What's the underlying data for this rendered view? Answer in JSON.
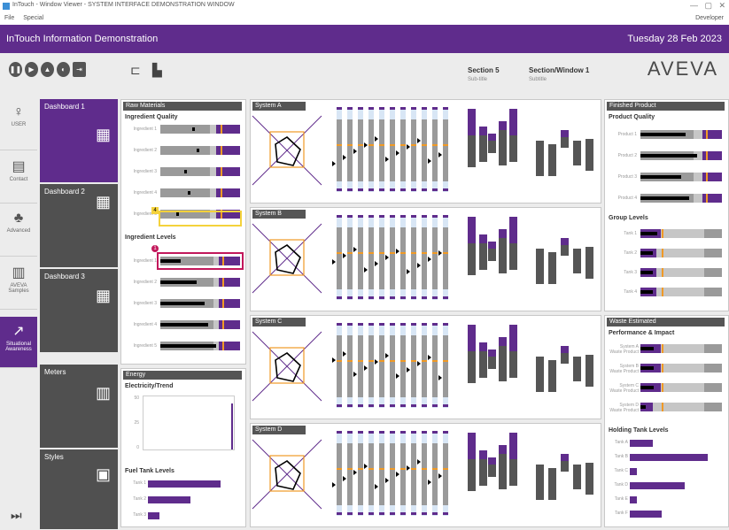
{
  "window": {
    "title": "InTouch - Window Viewer - SYSTEM INTERFACE DEMONSTRATION WINDOW",
    "menu": [
      "File",
      "Special"
    ],
    "menu_right": "Developer"
  },
  "header": {
    "title": "InTouch Information Demonstration",
    "date": "Tuesday 28 Feb 2023"
  },
  "toolbar": {
    "icons": [
      "pause-icon",
      "play-icon",
      "alarm-icon",
      "contrast-icon",
      "exit-icon"
    ],
    "section": {
      "label": "Section 5",
      "sub": "Sub-title"
    },
    "window": {
      "label": "Section/Window 1",
      "sub": "Subtitle"
    },
    "logo": "AVEVA"
  },
  "sidebar": {
    "items": [
      {
        "icon": "person-icon",
        "label": "USER"
      },
      {
        "icon": "contact-icon",
        "label": "Contact"
      },
      {
        "icon": "group-icon",
        "label": "Advanced"
      },
      {
        "icon": "samples-icon",
        "label": "AVEVA Samples"
      },
      {
        "icon": "graph-icon",
        "label": "Situational Awareness"
      }
    ],
    "bottom_icon": "skip-forward-icon"
  },
  "dashboards": [
    {
      "label": "Dashboard 1",
      "icon": "dashboard-icon",
      "active": true
    },
    {
      "label": "Dashboard 2",
      "icon": "dashboard-icon",
      "active": false
    },
    {
      "label": "Dashboard 3",
      "icon": "dashboard-icon",
      "active": false
    },
    {
      "label": "Meters",
      "icon": "meters-icon",
      "active": false
    },
    {
      "label": "Styles",
      "icon": "styles-icon",
      "active": false
    }
  ],
  "raw_materials": {
    "title": "Raw Materials",
    "quality_title": "Ingredient Quality",
    "quality_labels": [
      "Ingredient 1",
      "Ingredient 2",
      "Ingredient 3",
      "Ingredient 4",
      "Ingredient 5"
    ],
    "quality_levels": [
      0.4,
      0.45,
      0.3,
      0.35,
      0.2
    ],
    "level_title": "Ingredient Levels",
    "level_labels": [
      "Ingredient 1",
      "Ingredient 2",
      "Ingredient 3",
      "Ingredient 4",
      "Ingredient 5"
    ],
    "level_values": [
      0.25,
      0.45,
      0.55,
      0.6,
      0.7
    ],
    "alarm_badges": [
      "4",
      "1"
    ]
  },
  "energy": {
    "title": "Energy",
    "trend_title": "Electricity/Trend",
    "yaxis": [
      "50",
      "25",
      "0"
    ],
    "tank_title": "Fuel Tank Levels",
    "tanks": [
      {
        "name": "Tank 1",
        "level": 0.78
      },
      {
        "name": "Tank 2",
        "level": 0.46
      },
      {
        "name": "Tank 3",
        "level": 0.12
      }
    ]
  },
  "systems": [
    {
      "title": "System A"
    },
    {
      "title": "System B"
    },
    {
      "title": "System C"
    },
    {
      "title": "System D"
    }
  ],
  "finished": {
    "title": "Finished Product",
    "quality_title": "Product Quality",
    "quality_labels": [
      "Product 1",
      "Product 2",
      "Product 3",
      "Product 4"
    ],
    "quality_values": [
      0.55,
      0.7,
      0.5,
      0.6
    ],
    "group_title": "Group Levels",
    "group_labels": [
      "Tank 1",
      "Tank 2",
      "Tank 3",
      "Tank 4"
    ],
    "group_values": [
      0.25,
      0.2,
      0.2,
      0.2
    ]
  },
  "waste": {
    "title": "Waste Estimated",
    "perf_title": "Performance & Impact",
    "labels": [
      "System A Waste Product",
      "System B Waste Product",
      "System C Waste Product",
      "System D Waste Product"
    ],
    "values": [
      0.25,
      0.25,
      0.25,
      0.15
    ],
    "holding_title": "Holding Tank Levels",
    "holding": [
      {
        "name": "Tank A",
        "level": 0.25
      },
      {
        "name": "Tank B",
        "level": 0.85
      },
      {
        "name": "Tank C",
        "level": 0.08
      },
      {
        "name": "Tank D",
        "level": 0.6
      },
      {
        "name": "Tank E",
        "level": 0.08
      },
      {
        "name": "Tank F",
        "level": 0.35
      }
    ]
  },
  "colors": {
    "purple": "#5f2c8c",
    "orange": "#f09a26",
    "grey": "#c6c6c6",
    "dark": "#505050"
  }
}
